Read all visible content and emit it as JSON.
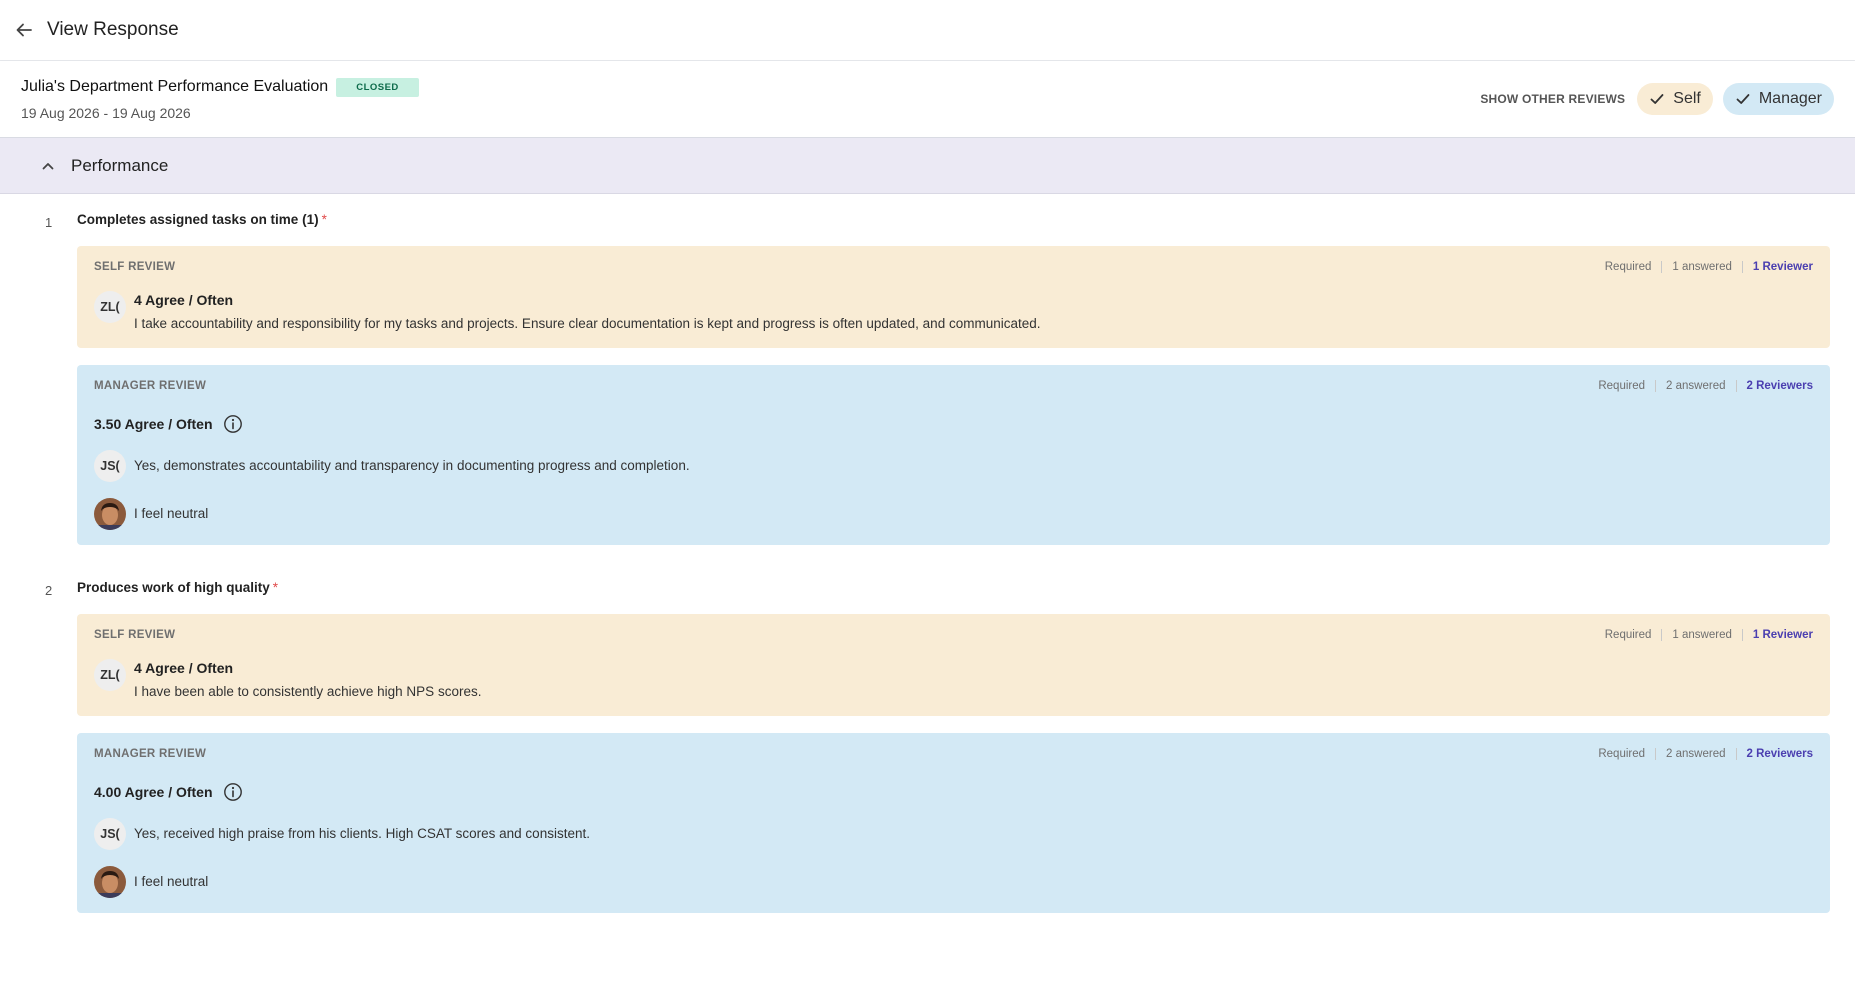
{
  "header": {
    "title": "View Response"
  },
  "form": {
    "title": "Julia's Department Performance Evaluation",
    "status": "CLOSED",
    "dates": "19 Aug 2026 - 19 Aug 2026",
    "show_others_label": "SHOW OTHER REVIEWS",
    "toggles": {
      "self": "Self",
      "manager": "Manager"
    }
  },
  "section": {
    "title": "Performance"
  },
  "questions": [
    {
      "number": "1",
      "title": "Completes assigned tasks on time (1)",
      "required_mark": "*",
      "self_review": {
        "label": "SELF REVIEW",
        "required": "Required",
        "answered": "1 answered",
        "reviewers": "1 Reviewer",
        "initials": "ZL(",
        "score": "4 Agree / Often",
        "comment": "I take accountability and responsibility for my tasks and projects. Ensure clear documentation is kept and progress is often updated, and communicated."
      },
      "manager_review": {
        "label": "MANAGER REVIEW",
        "required": "Required",
        "answered": "2 answered",
        "reviewers": "2 Reviewers",
        "score": "3.50 Agree / Often",
        "responses": [
          {
            "initials": "JS(",
            "comment": "Yes, demonstrates accountability and transparency in documenting progress and completion."
          },
          {
            "comment": "I feel neutral"
          }
        ]
      }
    },
    {
      "number": "2",
      "title": "Produces work of high quality",
      "required_mark": "*",
      "self_review": {
        "label": "SELF REVIEW",
        "required": "Required",
        "answered": "1 answered",
        "reviewers": "1 Reviewer",
        "initials": "ZL(",
        "score": "4 Agree / Often",
        "comment": "I have been able to consistently achieve high NPS scores."
      },
      "manager_review": {
        "label": "MANAGER REVIEW",
        "required": "Required",
        "answered": "2 answered",
        "reviewers": "2 Reviewers",
        "score": "4.00 Agree / Often",
        "responses": [
          {
            "initials": "JS(",
            "comment": "Yes, received high praise from his clients. High CSAT scores and consistent."
          },
          {
            "comment": "I feel neutral"
          }
        ]
      }
    }
  ],
  "icons": {
    "back": "arrow-left-icon",
    "check": "check-icon",
    "collapse": "chevron-up-icon",
    "info": "info-icon"
  },
  "colors": {
    "self_bg": "#f9ecd5",
    "manager_bg": "#d3e9f5",
    "section_bg": "#ebe9f4",
    "badge_bg": "#c7f0e1",
    "reviewer_link": "#4b3fb0"
  }
}
